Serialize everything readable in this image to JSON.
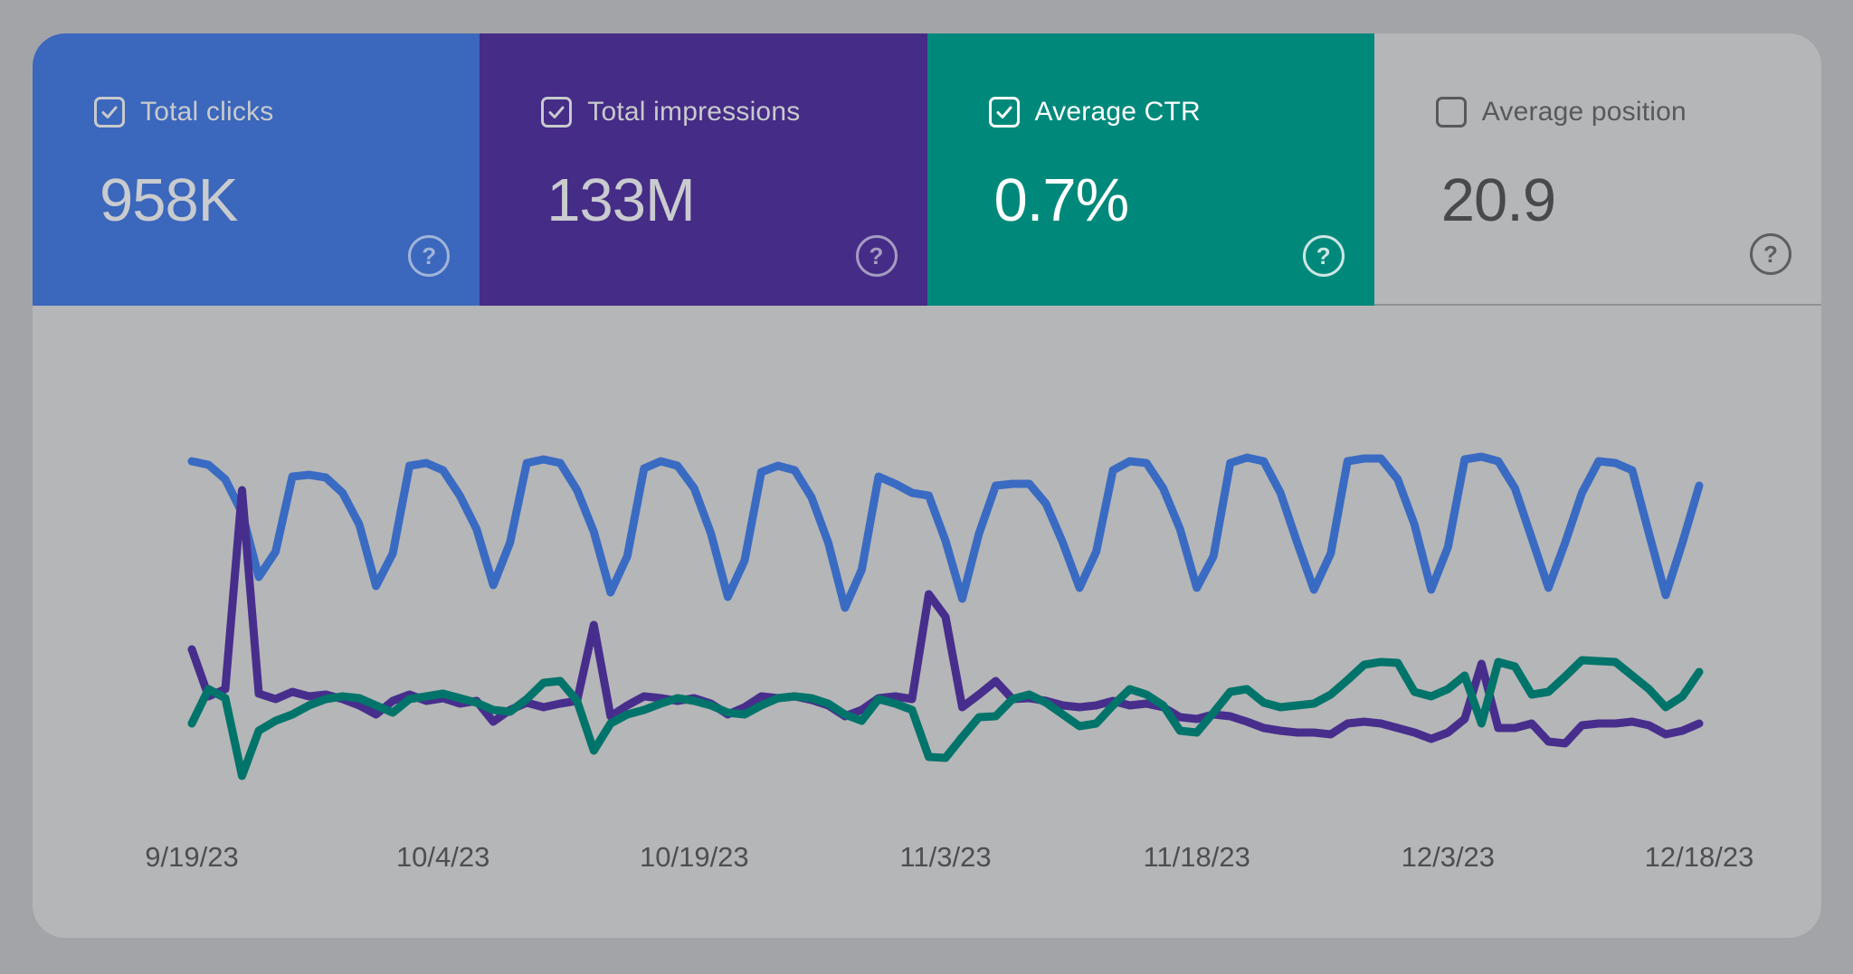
{
  "widget": "Search performance overview",
  "colors": {
    "outer_background": "#a3a4a8",
    "panel_background": "#b5b6b8",
    "axis_label_color": "#4c4e51",
    "card_divider_color": "#909194"
  },
  "icons": {
    "help_glyph": "?"
  },
  "metrics": [
    {
      "id": "total-clicks",
      "label": "Total clicks",
      "value": "958K",
      "checked": true,
      "background": "#3b67bc",
      "label_color": "#c8cacd",
      "value_color": "#c9cbce",
      "checkbox_color": "#c8cacd",
      "help_color": "rgba(228,231,235,0.6)"
    },
    {
      "id": "total-impressions",
      "label": "Total impressions",
      "value": "133M",
      "checked": true,
      "background": "#452c86",
      "label_color": "#c8cacd",
      "value_color": "#c9cbce",
      "checkbox_color": "#c8cacd",
      "help_color": "rgba(228,231,235,0.6)"
    },
    {
      "id": "average-ctr",
      "label": "Average CTR",
      "value": "0.7%",
      "checked": true,
      "background": "#00897b",
      "label_color": "#ffffff",
      "value_color": "#ffffff",
      "checkbox_color": "#ffffff",
      "help_color": "rgba(255,255,255,0.8)"
    },
    {
      "id": "average-position",
      "label": "Average position",
      "value": "20.9",
      "checked": false,
      "background": "#b5b6b8",
      "label_color": "#57595c",
      "value_color": "#47494c",
      "checkbox_color": "#57595c",
      "help_color": "#5c5e61",
      "underlined": true
    }
  ],
  "chart_data": {
    "type": "line",
    "title": "",
    "xlabel": "",
    "ylabel": "",
    "x_start": "9/19/23",
    "x_end": "12/18/23",
    "cadence": "daily",
    "points_per_series": 91,
    "x_tick_labels": [
      "9/19/23",
      "10/4/23",
      "10/19/23",
      "11/3/23",
      "11/18/23",
      "12/3/23",
      "12/18/23"
    ],
    "y_axis": "unlabeled relative scale 0-100 (no gridlines, no y ticks)",
    "grid": false,
    "legend": "none (series toggled via metric cards above)",
    "series": [
      {
        "name": "Total clicks",
        "color": "#3a6bc3",
        "values": [
          74,
          73.2,
          70,
          62.6,
          48.4,
          54,
          70.6,
          71,
          70.4,
          67,
          60,
          46.4,
          53.6,
          73,
          73.6,
          72,
          66.4,
          59,
          46.6,
          56,
          73.6,
          74.4,
          73.6,
          67.6,
          58.4,
          45,
          53,
          72.4,
          74,
          73,
          68,
          58,
          44,
          52,
          71.6,
          73,
          72,
          66,
          56,
          41.6,
          50,
          70.6,
          69,
          67,
          66.4,
          56.4,
          43.6,
          58,
          68.6,
          69,
          69,
          64.6,
          56,
          46,
          54,
          72,
          74,
          73.6,
          68,
          59,
          46,
          53,
          73.6,
          74.8,
          74,
          67,
          56,
          45.6,
          53.6,
          74,
          74.6,
          74.6,
          70,
          60,
          45.6,
          55,
          74.4,
          75,
          74,
          68,
          57,
          46,
          56,
          67,
          74,
          73.6,
          72,
          58,
          44.4,
          56,
          68.6
        ]
      },
      {
        "name": "Total impressions",
        "color": "#472e8d",
        "values": [
          32.4,
          22,
          23.6,
          67.6,
          22.6,
          21.4,
          23,
          22,
          22.4,
          21.4,
          20,
          18,
          21,
          22.4,
          21,
          21.6,
          20.4,
          21,
          16.4,
          19,
          20.6,
          19.6,
          20.4,
          21,
          37.8,
          17.6,
          20,
          22,
          21.6,
          21,
          21.6,
          20.4,
          18,
          19.6,
          22,
          21.6,
          22,
          21.2,
          20,
          17.6,
          19,
          21.6,
          22,
          21.4,
          44.6,
          39.6,
          19.6,
          22.4,
          25.4,
          21.4,
          21.6,
          21,
          20,
          19.6,
          20,
          21,
          20,
          20.4,
          19.6,
          17.4,
          17,
          18,
          17.6,
          16.4,
          15,
          14.4,
          14,
          14,
          13.6,
          16,
          16.4,
          16,
          15,
          14,
          12.6,
          14,
          17,
          29.2,
          15,
          15,
          16,
          12,
          11.6,
          15.6,
          16,
          16,
          16.4,
          15.6,
          13.6,
          14.4,
          16
        ]
      },
      {
        "name": "Average CTR",
        "color": "#00746a",
        "values": [
          16,
          23.6,
          21.6,
          4.4,
          14.4,
          16.6,
          18,
          20,
          21.4,
          22,
          21.6,
          20,
          18.4,
          21.4,
          22,
          22.6,
          21.6,
          20.6,
          19,
          18.6,
          21.4,
          25,
          25.4,
          21,
          10,
          16,
          18,
          19,
          20.4,
          21.6,
          21,
          20,
          18.4,
          18,
          20,
          21.6,
          22,
          21.6,
          20.4,
          18,
          16.6,
          21.4,
          20.4,
          19,
          8.6,
          8.4,
          13,
          17.4,
          17.6,
          21.4,
          22.4,
          20.6,
          18,
          15.4,
          16,
          20,
          23.6,
          22.4,
          20,
          14.4,
          14,
          18.4,
          23,
          23.6,
          20.6,
          19.6,
          20,
          20.4,
          22.4,
          25.6,
          29,
          29.6,
          29.4,
          23,
          22,
          23.6,
          26.6,
          16,
          29.6,
          28.6,
          22.4,
          23,
          26.4,
          30,
          29.8,
          29.6,
          26.6,
          23.6,
          19.6,
          22,
          27.4
        ]
      }
    ]
  }
}
